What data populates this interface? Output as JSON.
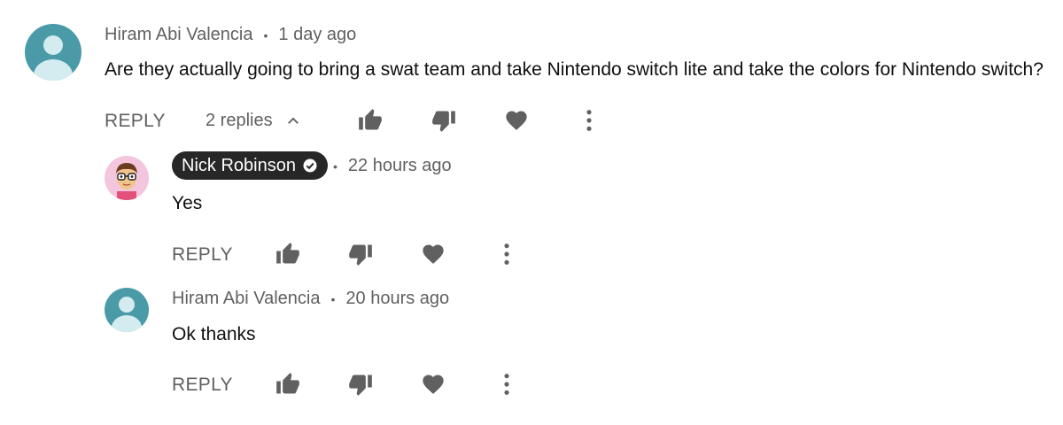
{
  "comments": [
    {
      "author": "Hiram Abi Valencia",
      "time": "1 day ago",
      "text": "Are they actually going to bring a swat team and take Nintendo switch lite and take the colors for Nintendo switch?",
      "reply_label": "REPLY",
      "replies_label": "2 replies"
    }
  ],
  "replies": [
    {
      "author": "Nick Robinson",
      "is_owner": true,
      "time": "22 hours ago",
      "text": "Yes",
      "reply_label": "REPLY"
    },
    {
      "author": "Hiram Abi Valencia",
      "time": "20 hours ago",
      "text": "Ok thanks",
      "reply_label": "REPLY"
    }
  ],
  "icons": {
    "like": "thumbs-up-icon",
    "dislike": "thumbs-down-icon",
    "heart": "heart-icon",
    "more": "more-vertical-icon",
    "verified": "verified-check-icon",
    "collapse": "chevron-up-icon"
  },
  "colors": {
    "secondary_text": "#606060",
    "avatar_teal": "#4a9aa8",
    "owner_chip_bg": "#272727"
  }
}
